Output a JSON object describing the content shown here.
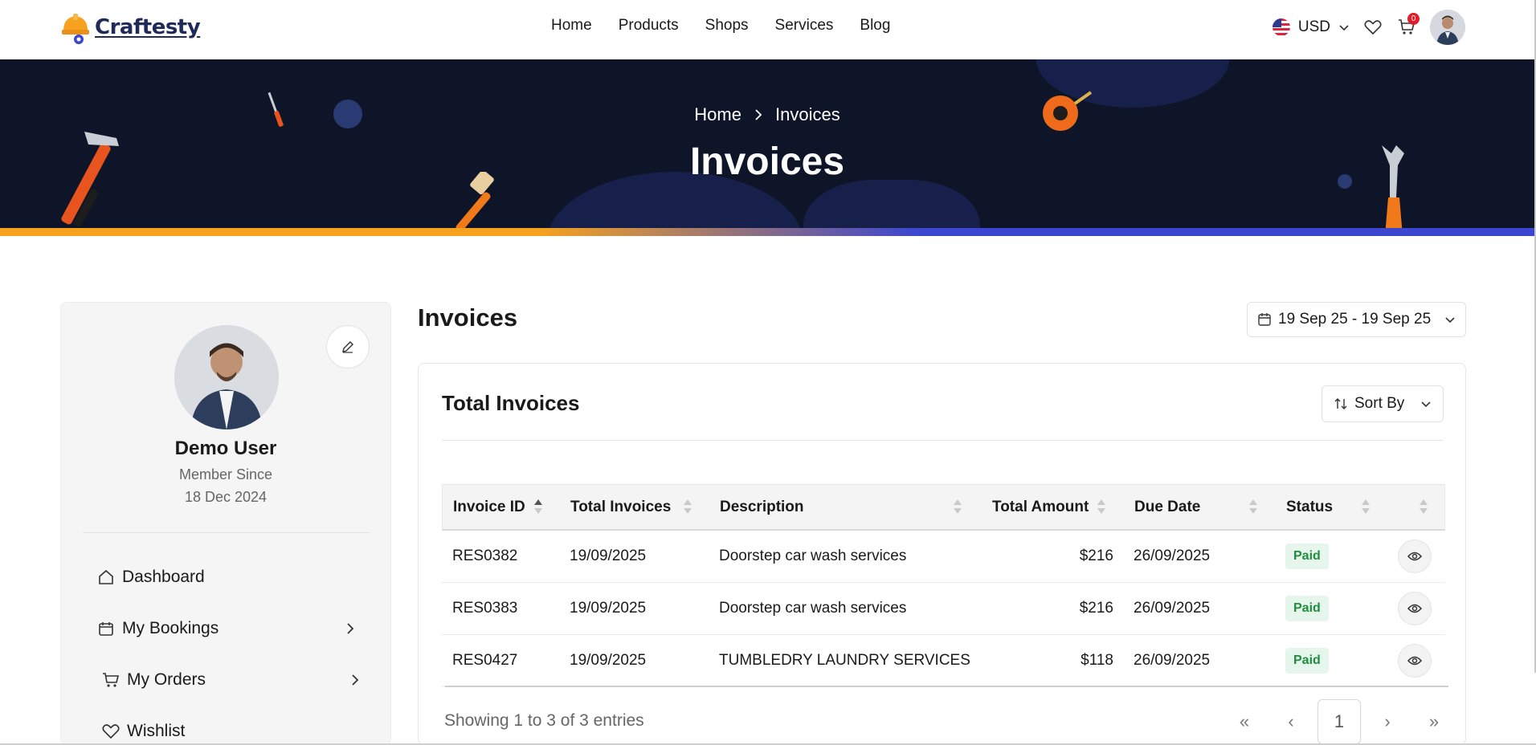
{
  "brand": {
    "name": "Craftesty"
  },
  "nav": [
    {
      "label": "Home"
    },
    {
      "label": "Products"
    },
    {
      "label": "Shops"
    },
    {
      "label": "Services"
    },
    {
      "label": "Blog"
    }
  ],
  "header": {
    "currency": "USD",
    "cart_count": "0"
  },
  "hero": {
    "breadcrumb": {
      "home": "Home",
      "current": "Invoices"
    },
    "title": "Invoices"
  },
  "profile": {
    "name": "Demo User",
    "member_since_label": "Member Since",
    "member_since_date": "18 Dec 2024"
  },
  "sidebar": {
    "items": [
      {
        "label": "Dashboard",
        "icon": "home-icon",
        "has_chevron": false
      },
      {
        "label": "My Bookings",
        "icon": "calendar-icon",
        "has_chevron": true
      },
      {
        "label": "My Orders",
        "icon": "cart-icon",
        "has_chevron": true
      },
      {
        "label": "Wishlist",
        "icon": "heart-icon",
        "has_chevron": false
      }
    ]
  },
  "main": {
    "title": "Invoices",
    "date_range": "19 Sep 25 - 19 Sep 25",
    "card_title": "Total Invoices",
    "sort_label": "Sort By"
  },
  "table": {
    "columns": [
      "Invoice ID",
      "Total Invoices",
      "Description",
      "Total Amount",
      "Due Date",
      "Status"
    ],
    "rows": [
      {
        "id": "RES0382",
        "date": "19/09/2025",
        "description": "Doorstep car wash services",
        "amount": "$216",
        "due": "26/09/2025",
        "status": "Paid"
      },
      {
        "id": "RES0383",
        "date": "19/09/2025",
        "description": "Doorstep car wash services",
        "amount": "$216",
        "due": "26/09/2025",
        "status": "Paid"
      },
      {
        "id": "RES0427",
        "date": "19/09/2025",
        "description": "TUMBLEDRY LAUNDRY SERVICES",
        "amount": "$118",
        "due": "26/09/2025",
        "status": "Paid"
      }
    ]
  },
  "pagination": {
    "summary": "Showing 1 to 3 of 3 entries",
    "first": "«",
    "prev": "‹",
    "current": "1",
    "next": "›",
    "last": "»"
  },
  "colors": {
    "hero_bg": "#0f1528",
    "accent_orange": "#f6a21e",
    "accent_blue": "#3b46d1",
    "paid_bg": "#e7f6ec",
    "paid_text": "#1e8e3e"
  }
}
